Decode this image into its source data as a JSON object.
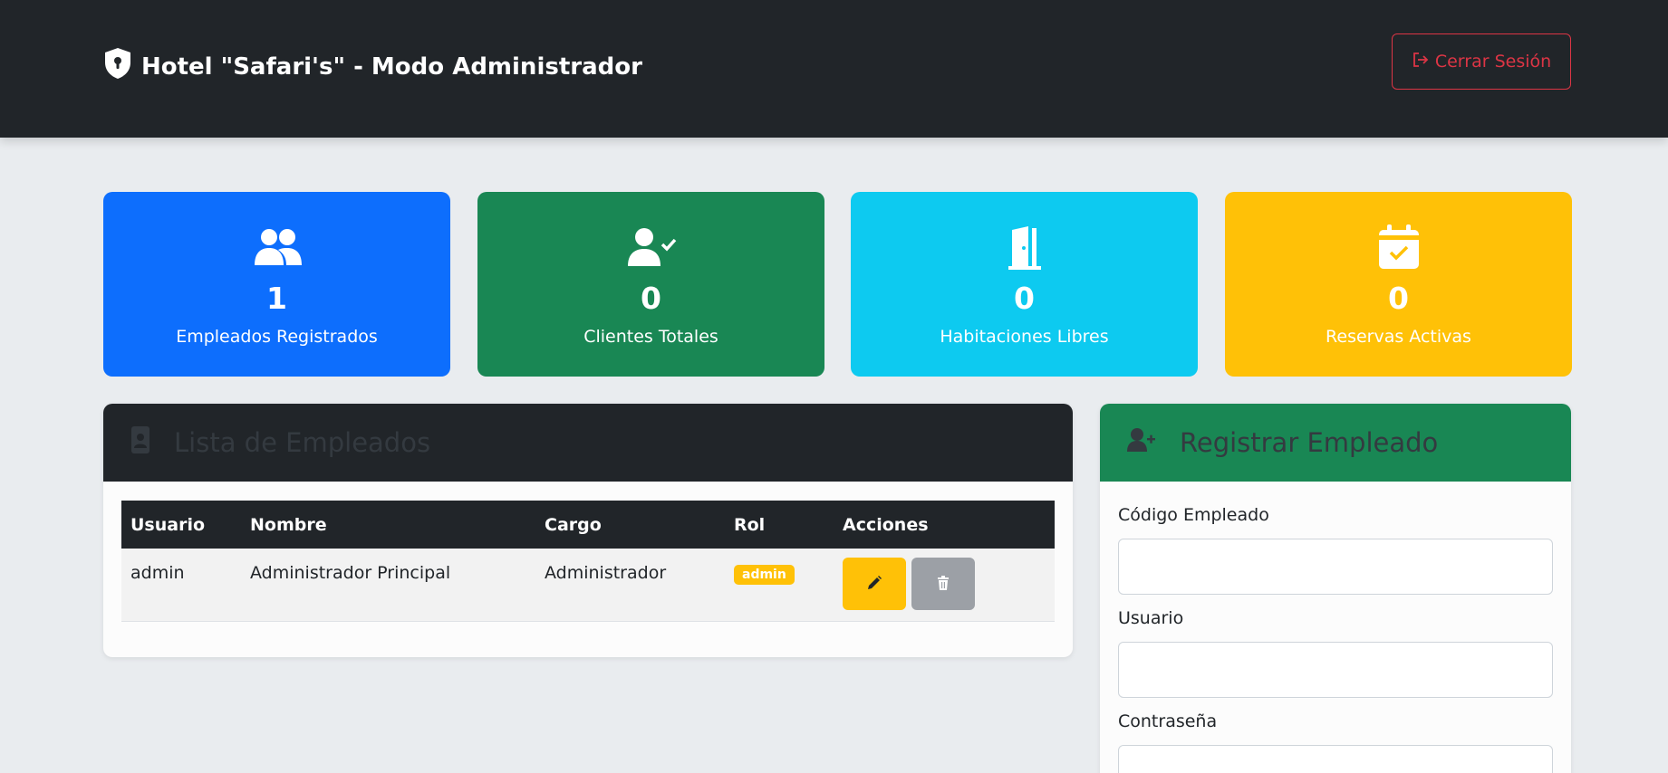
{
  "header": {
    "title": "Hotel \"Safari's\" - Modo Administrador",
    "logout_label": "Cerrar Sesión"
  },
  "stats": [
    {
      "value": "1",
      "label": "Empleados Registrados",
      "color": "#0d6efd",
      "icon": "users-icon"
    },
    {
      "value": "0",
      "label": "Clientes Totales",
      "color": "#198754",
      "icon": "user-check-icon"
    },
    {
      "value": "0",
      "label": "Habitaciones Libres",
      "color": "#0dcaf0",
      "icon": "door-open-icon"
    },
    {
      "value": "0",
      "label": "Reservas Activas",
      "color": "#ffc107",
      "icon": "calendar-check-icon"
    }
  ],
  "employee_list": {
    "title": "Lista de Empleados",
    "columns": [
      "Usuario",
      "Nombre",
      "Cargo",
      "Rol",
      "Acciones"
    ],
    "rows": [
      {
        "usuario": "admin",
        "nombre": "Administrador Principal",
        "cargo": "Administrador",
        "rol": "admin"
      }
    ]
  },
  "register_form": {
    "title": "Registrar Empleado",
    "fields": [
      {
        "label": "Código Empleado",
        "value": ""
      },
      {
        "label": "Usuario",
        "value": ""
      },
      {
        "label": "Contraseña",
        "value": ""
      }
    ]
  }
}
